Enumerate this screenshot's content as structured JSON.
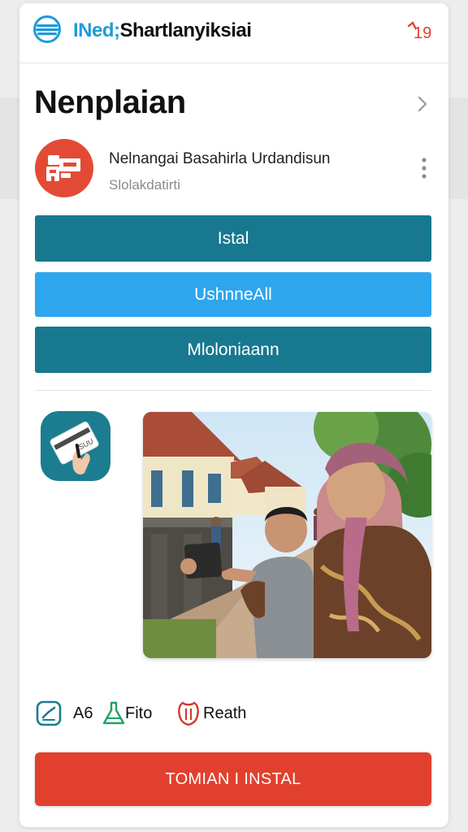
{
  "header": {
    "brand_part1": "INed;",
    "brand_part2": "Shartlanyiksiai",
    "badge_text": "19",
    "logo_icon": "globe-icon",
    "badge_icon": "notification-badge-icon"
  },
  "page": {
    "title": "Nenplaian",
    "chevron_icon": "chevron-right-icon"
  },
  "app": {
    "name": "Nelnangai Basahirla Urdandisun",
    "subtitle": "Slolakdatirti",
    "icon": "app-logo-icon",
    "more_icon": "more-vertical-icon"
  },
  "actions": {
    "button1": "Istal",
    "button2": "UshnneAll",
    "button3": "Mloloniaann"
  },
  "promo": {
    "icon": "card-payment-icon",
    "icon_text": "ISUU",
    "photo": "photo-family-with-phone"
  },
  "features": [
    {
      "icon": "checklist-icon",
      "label": "A6"
    },
    {
      "icon": "flask-icon",
      "label": "Fito"
    },
    {
      "icon": "shield-icon",
      "label": "Reath"
    }
  ],
  "install": {
    "label": "TOMIAN I INSTAL"
  },
  "colors": {
    "brand_blue": "#1e9bd8",
    "teal": "#17788f",
    "sky": "#2ea6ee",
    "red": "#e1402e"
  }
}
